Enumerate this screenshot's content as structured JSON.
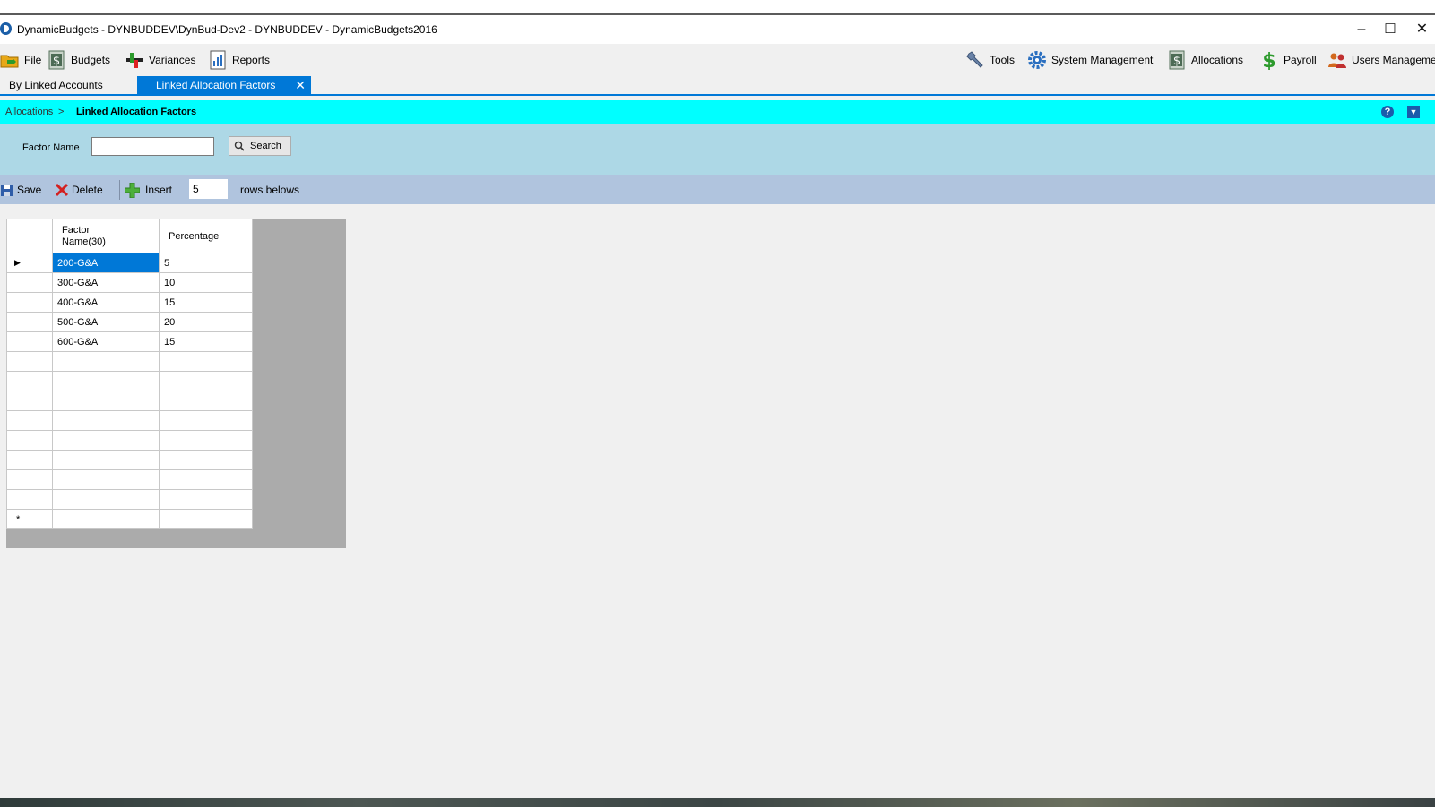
{
  "window": {
    "title": "DynamicBudgets - DYNBUDDEV\\DynBud-Dev2 - DYNBUDDEV - DynamicBudgets2016",
    "minimize": "–",
    "maximize": "☐",
    "close": "✕"
  },
  "menu": {
    "left": [
      {
        "label": "File",
        "icon": "folder-icon"
      },
      {
        "label": "Budgets",
        "icon": "dollar-doc-icon"
      },
      {
        "label": "Variances",
        "icon": "plus-minus-icon"
      },
      {
        "label": "Reports",
        "icon": "report-chart-icon"
      }
    ],
    "right": [
      {
        "label": "Tools",
        "icon": "wrench-icon"
      },
      {
        "label": "System Management",
        "icon": "gear-icon"
      },
      {
        "label": "Allocations",
        "icon": "dollar-doc-icon"
      },
      {
        "label": "Payroll",
        "icon": "dollar-icon"
      },
      {
        "label": "Users Management",
        "icon": "users-icon"
      }
    ]
  },
  "tabs": [
    {
      "label": "By Linked Accounts",
      "active": false
    },
    {
      "label": "Linked Allocation Factors",
      "active": true,
      "close": "✕"
    }
  ],
  "breadcrumb": {
    "parent": "Allocations",
    "separator": ">",
    "current": "Linked Allocation Factors",
    "help": "?",
    "dropdown": "▼"
  },
  "search": {
    "label": "Factor Name",
    "value": "",
    "button": "Search"
  },
  "toolbar": {
    "save": "Save",
    "delete": "Delete",
    "insert": "Insert",
    "rows_value": "5",
    "rows_label": "rows belows"
  },
  "grid": {
    "columns": [
      "Factor Name(30)",
      "Percentage"
    ],
    "rows": [
      {
        "name": "200-G&A",
        "pct": "5"
      },
      {
        "name": "300-G&A",
        "pct": "10"
      },
      {
        "name": "400-G&A",
        "pct": "15"
      },
      {
        "name": "500-G&A",
        "pct": "20"
      },
      {
        "name": "600-G&A",
        "pct": "15"
      }
    ],
    "current_row_marker": "▶",
    "new_row_marker": "*"
  },
  "colors": {
    "accent": "#0078d7",
    "breadcrumb_bg": "#00ffff",
    "search_bg": "#add8e6",
    "toolbar_bg": "#b0c4de"
  }
}
